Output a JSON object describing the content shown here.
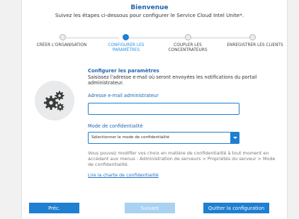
{
  "header": {
    "title": "Bienvenue",
    "subtitle": "Suivez les étapes ci-dessous pour configurer le Service Cloud Intel Unite*."
  },
  "steps": [
    {
      "label": "CRÉER L'ORGANISATION",
      "state": "done"
    },
    {
      "label": "CONFIGURER LES PARAMÈTRES",
      "state": "active"
    },
    {
      "label": "COUPLER LES CONCENTRATEURS",
      "state": "pending"
    },
    {
      "label": "ENREGISTRER LES CLIENTS",
      "state": "pending"
    }
  ],
  "section": {
    "icon": "gears-icon",
    "title": "Configurer les paramètres",
    "description": "Saisissez l'adresse e-mail où seront envoyées les notifications du portail administrateur."
  },
  "email": {
    "label": "Adresse e-mail administrateur",
    "value": "",
    "placeholder": ""
  },
  "privacy": {
    "label": "Mode de confidentialité",
    "selected": "Sélectionner le mode de confidentialité",
    "note": "Vous pouvez modifier vos choix en matière de confidentialité à tout moment en accédant aux menus : Administration de serveurs > Propriétés du serveur > Mode de confidentialité.",
    "link": "Lire la charte de confidentialité"
  },
  "buttons": {
    "prev": "Préc.",
    "next": "Suivant",
    "quit": "Quitter la configuration"
  },
  "colors": {
    "accent": "#1f7fd0",
    "title": "#1f64b0",
    "disabled": "#a8d1f2"
  }
}
